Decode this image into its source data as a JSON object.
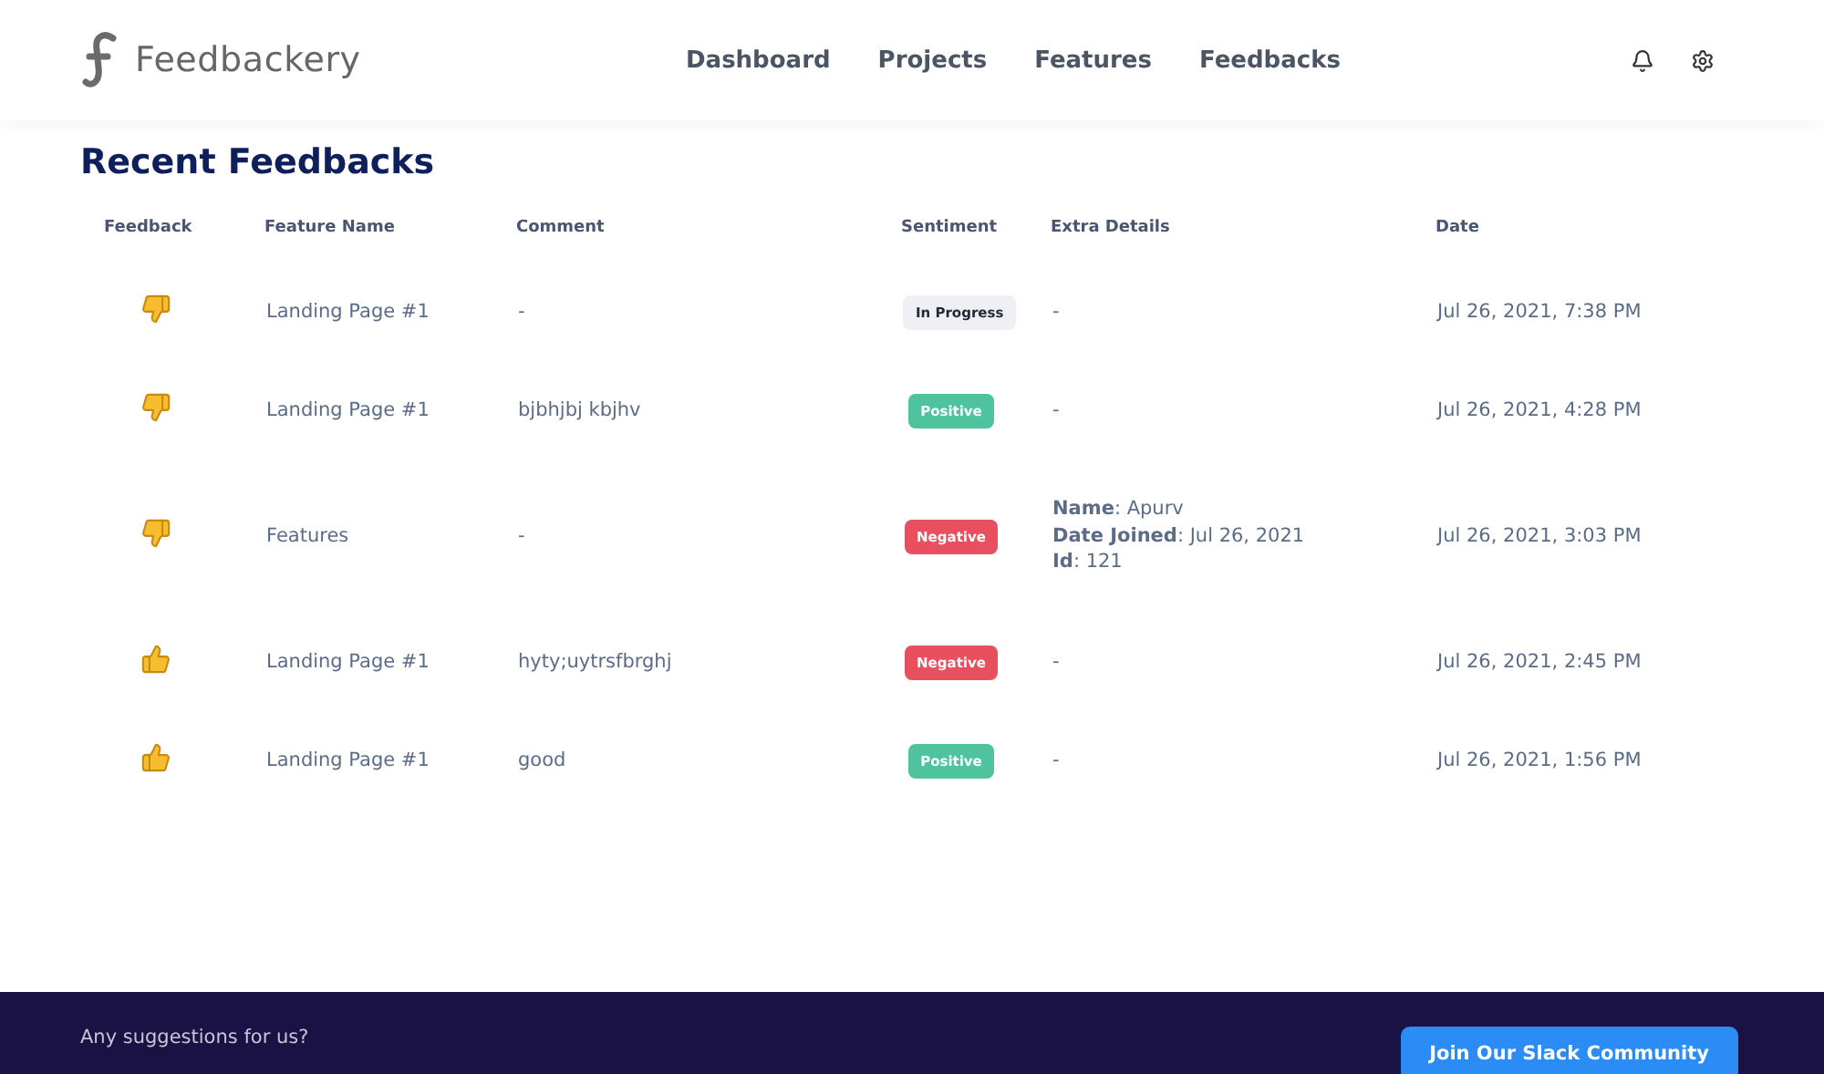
{
  "brand": {
    "name": "Feedbackery"
  },
  "nav": [
    {
      "label": "Dashboard"
    },
    {
      "label": "Projects"
    },
    {
      "label": "Features"
    },
    {
      "label": "Feedbacks"
    }
  ],
  "title": "Recent Feedbacks",
  "table": {
    "columns": [
      "Feedback",
      "Feature Name",
      "Comment",
      "Sentiment",
      "Extra Details",
      "Date"
    ],
    "rows": [
      {
        "liked": false,
        "feature": "Landing Page #1",
        "comment": "-",
        "sentiment": {
          "kind": "in_progress",
          "label": "In Progress"
        },
        "extra": [
          "-"
        ],
        "date": "Jul 26, 2021, 7:38 PM"
      },
      {
        "liked": false,
        "feature": "Landing Page #1",
        "comment": "bjbhjbj kbjhv",
        "sentiment": {
          "kind": "positive",
          "label": "Positive"
        },
        "extra": [
          "-"
        ],
        "date": "Jul 26, 2021, 4:28 PM"
      },
      {
        "liked": false,
        "feature": "Features",
        "comment": "-",
        "sentiment": {
          "kind": "negative",
          "label": "Negative"
        },
        "extra": [
          "**Name**: Apurv",
          "**Date Joined**: Jul 26, 2021",
          "**Id**: 121"
        ],
        "date": "Jul 26, 2021, 3:03 PM"
      },
      {
        "liked": true,
        "feature": "Landing Page #1",
        "comment": "hyty;uytrsfbrghj",
        "sentiment": {
          "kind": "negative",
          "label": "Negative"
        },
        "extra": [
          "-"
        ],
        "date": "Jul 26, 2021, 2:45 PM"
      },
      {
        "liked": true,
        "feature": "Landing Page #1",
        "comment": "good",
        "sentiment": {
          "kind": "positive",
          "label": "Positive"
        },
        "extra": [
          "-"
        ],
        "date": "Jul 26, 2021, 1:56 PM"
      }
    ]
  },
  "footer": {
    "prompt": "Any suggestions for us?",
    "button": "Join Our Slack Community"
  }
}
